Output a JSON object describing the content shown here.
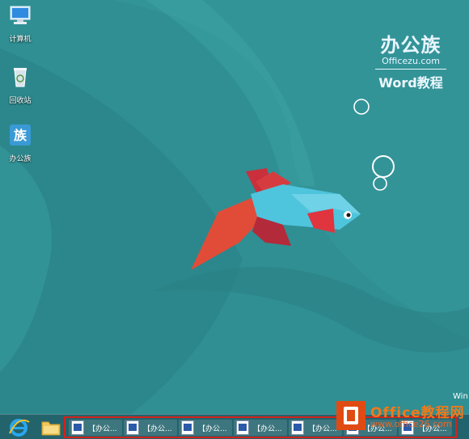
{
  "desktop": {
    "icons": [
      {
        "label": "计算机",
        "icon": "computer-icon"
      },
      {
        "label": "回收站",
        "icon": "recycle-bin-icon"
      },
      {
        "label": "办公族",
        "icon": "bangongzu-icon"
      }
    ],
    "brand": {
      "logo": "办公族",
      "site": "Officezu.com",
      "title": "Word教程"
    },
    "os_watermark": "Win"
  },
  "taskbar": {
    "pinned": [
      {
        "name": "internet-explorer",
        "icon": "ie-icon"
      },
      {
        "name": "file-explorer",
        "icon": "folder-icon"
      }
    ],
    "tasks": [
      {
        "label": "【办公..."
      },
      {
        "label": "【办公..."
      },
      {
        "label": "【办公..."
      },
      {
        "label": "【办公..."
      },
      {
        "label": "【办公..."
      },
      {
        "label": "【办公..."
      },
      {
        "label": "【办公..."
      }
    ],
    "highlight_color": "#d2221c"
  },
  "watermark": {
    "title": "Office教程网",
    "url": "www.office26.com"
  },
  "colors": {
    "desktop_bg": "#2f8f93",
    "fish_blue": "#4fc4dd",
    "fish_red": "#c9303c",
    "fish_orange": "#e14c38"
  }
}
